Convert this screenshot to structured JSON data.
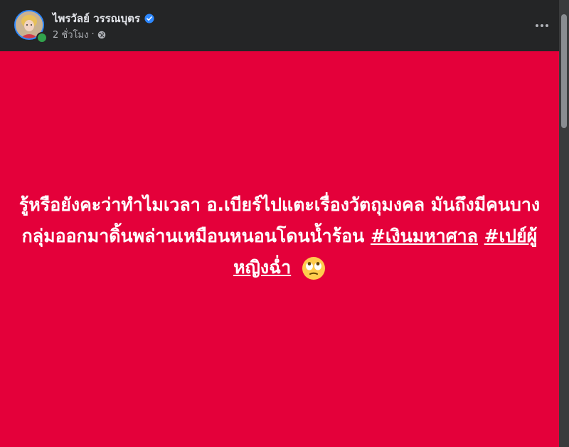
{
  "post": {
    "author_name": "ไพรวัลย์ วรรณบุตร",
    "verified": true,
    "timestamp": "2 ชั่วโมง",
    "separator": "·",
    "privacy_icon": "globe-icon",
    "more_icon": "more-horizontal-icon",
    "background_color": "#e4003a",
    "text_plain": "รู้หรือยังคะว่าทำไมเวลา อ.เบียร์ไปแตะเรื่องวัตถุมงคล มันถึงมีคนบางกลุ่มออกมาดิ้นพล่านเหมือนหนอนโดนน้ำร้อน ",
    "hashtags": [
      "#เงินมหาศาล",
      "#เปย์ผู้หญิงฉ่ำ"
    ],
    "emoji": "face-with-rolling-eyes-icon"
  }
}
